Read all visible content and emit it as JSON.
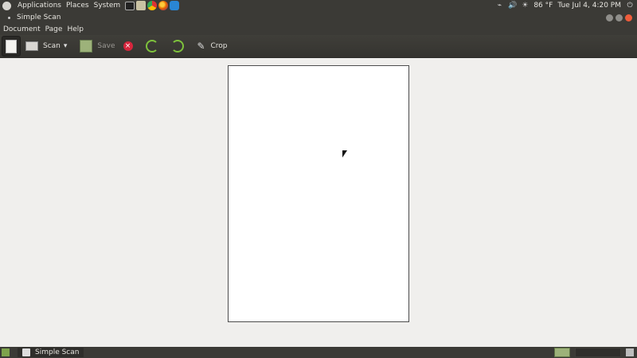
{
  "topbar": {
    "menus": [
      "Applications",
      "Places",
      "System"
    ],
    "weather": "86 °F",
    "clock": "Tue Jul  4,  4:20 PM"
  },
  "window": {
    "title": "Simple Scan"
  },
  "menubar": [
    "Document",
    "Page",
    "Help"
  ],
  "toolbar": {
    "scan_label": "Scan",
    "save_label": "Save",
    "crop_label": "Crop"
  },
  "taskbar": {
    "task_label": "Simple Scan"
  }
}
